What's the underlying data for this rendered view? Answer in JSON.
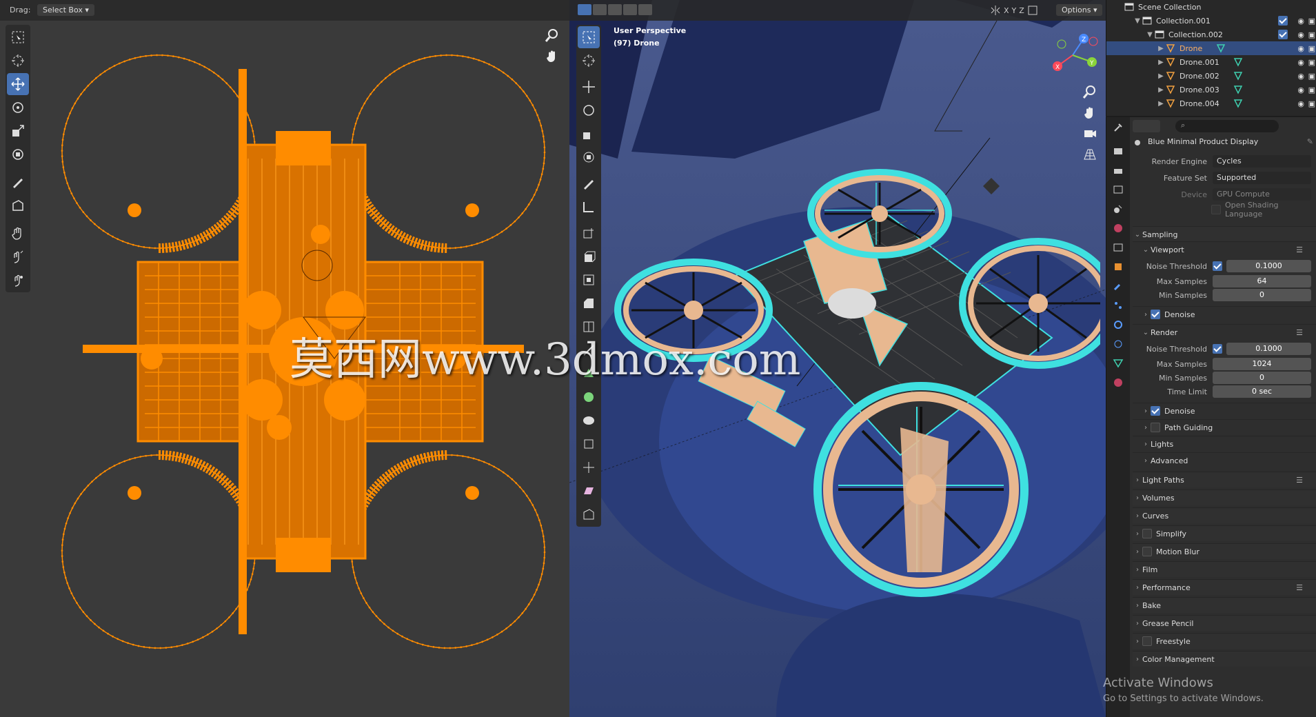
{
  "left_view": {
    "drag_label": "Drag:",
    "drag_mode": "Select Box"
  },
  "viewport": {
    "perspective_label": "User Perspective",
    "object_label": "(97) Drone",
    "axis_x": "X",
    "axis_y": "Y",
    "axis_z": "Z",
    "options_label": "Options"
  },
  "outliner": {
    "items": [
      {
        "label": "Scene Collection"
      },
      {
        "label": "Collection.001"
      },
      {
        "label": "Collection.002"
      },
      {
        "label": "Drone"
      },
      {
        "label": "Drone.001"
      },
      {
        "label": "Drone.002"
      },
      {
        "label": "Drone.003"
      },
      {
        "label": "Drone.004"
      }
    ]
  },
  "properties": {
    "scene_name": "Blue Minimal Product Display",
    "render_engine_label": "Render Engine",
    "render_engine": "Cycles",
    "feature_set_label": "Feature Set",
    "feature_set": "Supported",
    "device_label": "Device",
    "device": "GPU Compute",
    "osl_label": "Open Shading Language",
    "sampling": "Sampling",
    "viewport": "Viewport",
    "noise_threshold_label": "Noise Threshold",
    "viewport_noise_threshold": "0.1000",
    "max_samples_label": "Max Samples",
    "viewport_max_samples": "64",
    "min_samples_label": "Min Samples",
    "viewport_min_samples": "0",
    "denoise_label": "Denoise",
    "render": "Render",
    "render_noise_threshold": "0.1000",
    "render_max_samples": "1024",
    "render_min_samples": "0",
    "time_limit_label": "Time Limit",
    "time_limit": "0 sec",
    "path_guiding": "Path Guiding",
    "lights": "Lights",
    "advanced": "Advanced",
    "light_paths": "Light Paths",
    "volumes": "Volumes",
    "curves": "Curves",
    "simplify": "Simplify",
    "motion_blur": "Motion Blur",
    "film": "Film",
    "performance": "Performance",
    "bake": "Bake",
    "grease_pencil": "Grease Pencil",
    "freestyle": "Freestyle",
    "color_management": "Color Management"
  },
  "overlay": {
    "watermark": "莫西网www.3dmox.com",
    "activate_title": "Activate Windows",
    "activate_sub": "Go to Settings to activate Windows."
  },
  "colors": {
    "accent": "#4772b3",
    "mesh_orange": "#ff8c00",
    "viewport_blue": "#3b4a7a",
    "wire_cyan": "#3fe0e0"
  }
}
